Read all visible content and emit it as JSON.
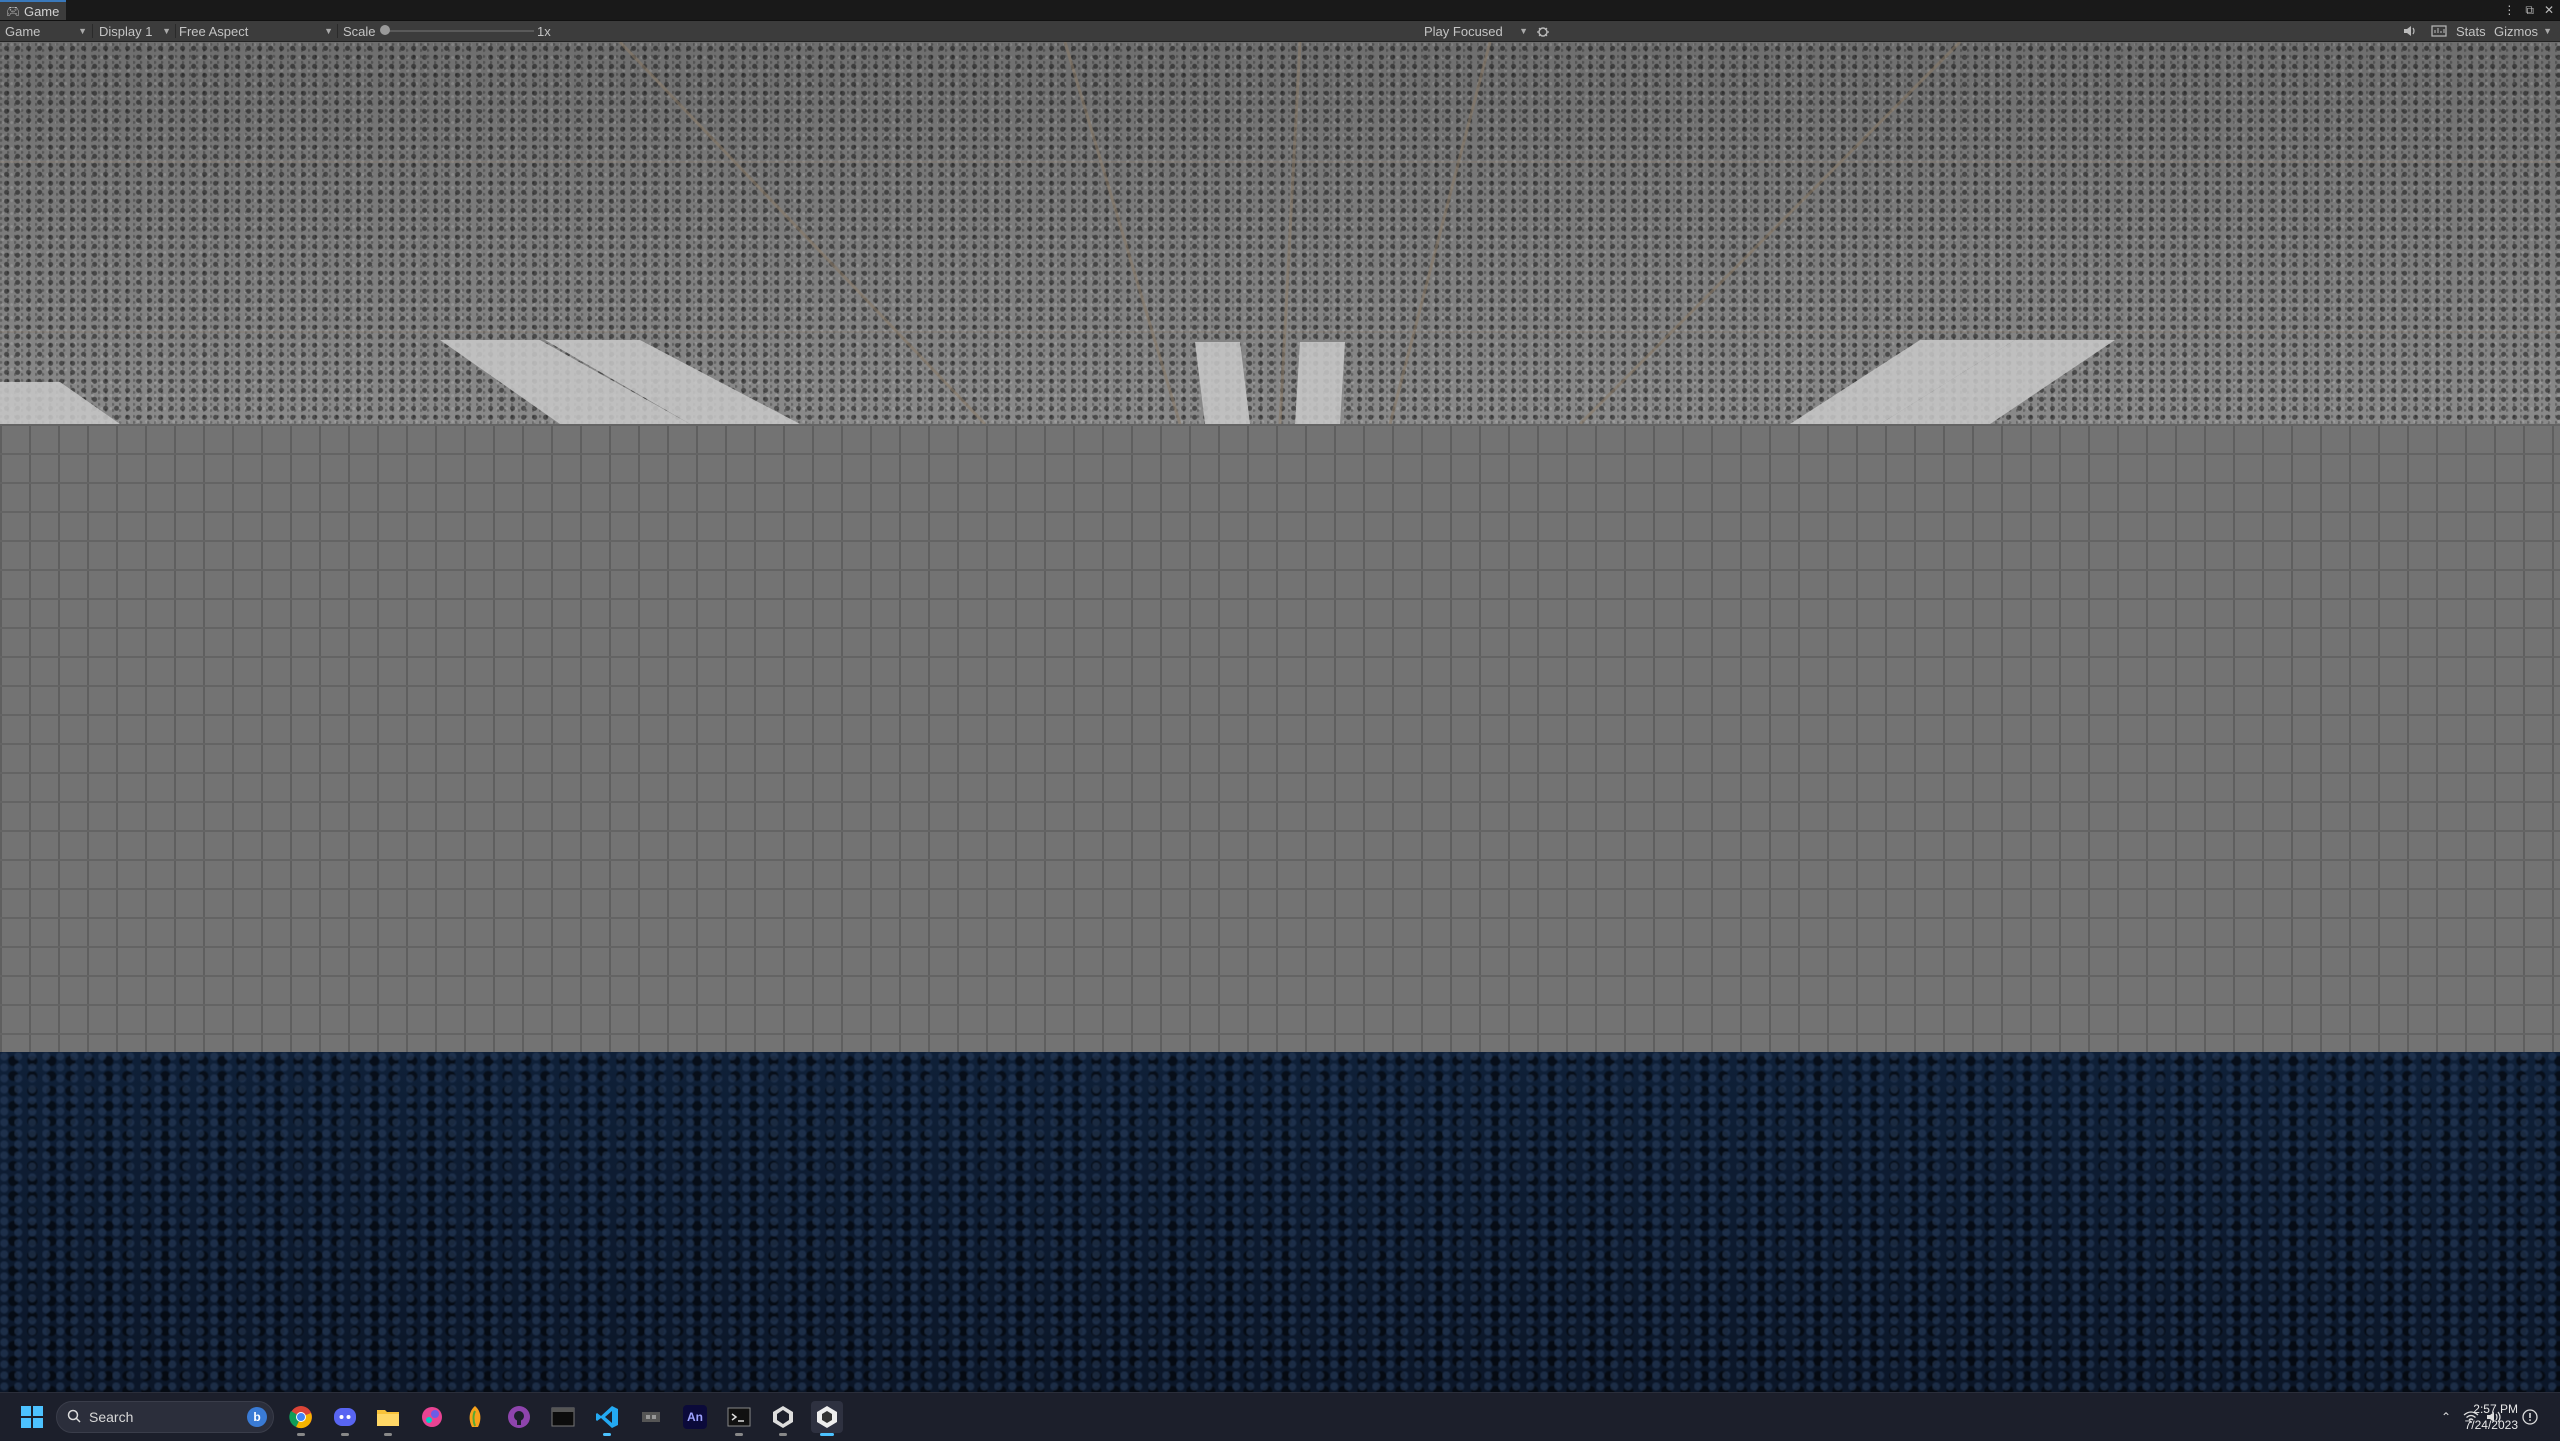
{
  "window": {
    "tab_label": "Game",
    "controls": [
      "kebab-menu-icon",
      "maximize-icon",
      "close-icon"
    ]
  },
  "toolbar": {
    "view_mode": "Game",
    "display": "Display 1",
    "aspect": "Free Aspect",
    "scale_label": "Scale",
    "scale_value": "1x",
    "play_mode": "Play Focused",
    "stats_label": "Stats",
    "gizmos_label": "Gizmos"
  },
  "scene": {
    "ceiling_color": "#7c7c7c",
    "wall_color": "#737373",
    "floor_color": "#0e1c31"
  },
  "taskbar": {
    "search_placeholder": "Search",
    "apps": [
      "windows-start-icon",
      "chrome-icon",
      "discord-icon",
      "file-explorer-icon",
      "paint-icon",
      "fl-studio-icon",
      "github-desktop-icon",
      "terminal-icon",
      "vscode-icon",
      "aseprite-icon",
      "animate-icon",
      "command-prompt-icon",
      "unity-hub-icon",
      "unity-editor-icon"
    ],
    "time": "2:57 PM",
    "date": "7/24/2023"
  }
}
